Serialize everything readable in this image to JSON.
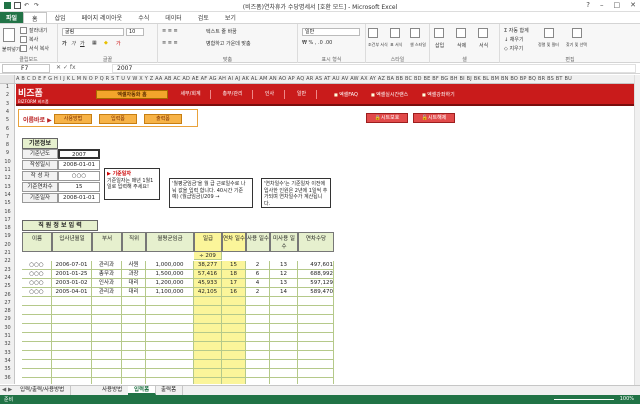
{
  "window": {
    "title": "(비즈폼)연차휴가 수당명세서 [호환 모드] - Microsoft Excel"
  },
  "tabs": [
    "파일",
    "홈",
    "삽입",
    "페이지 레이아웃",
    "수식",
    "데이터",
    "검토",
    "보기"
  ],
  "ribbon": {
    "paste": "붙여넣기",
    "cut": "잘라내기",
    "copy": "복사",
    "format_painter": "서식 복사",
    "clipboard": "클립보드",
    "font_name": "굴림",
    "font_size": "10",
    "font_group": "글꼴",
    "align_group": "맞춤",
    "wrap": "텍스트 줄 바꿈",
    "merge": "병합하고 가운데 맞춤",
    "number_format": "일반",
    "number_group": "표시 형식",
    "cond_fmt": "조건부 서식",
    "table_fmt": "표 서식",
    "cell_style": "셀 스타일",
    "style_group": "스타일",
    "insert": "삽입",
    "delete": "삭제",
    "format": "서식",
    "cells_group": "셀",
    "autosum": "자동 합계",
    "fill": "채우기",
    "clear": "지우기",
    "sort": "정렬 및 필터",
    "find": "찾기 및 선택",
    "edit_group": "편집"
  },
  "formula": {
    "name_box": "F7",
    "value": "2007"
  },
  "columns": "A B C D E F G H I J K L M N O P Q R S T U V W X Y Z AA AB AC AD AE AF AG AH AI AJ AK AL AM AN AO AP AQ AR AS AT AU AV AW AX AY AZ BA BB BC BD BE BF BG BH BI BJ BK BL BM BN BO BP BQ BR BS BT BU",
  "rows": [
    "1",
    "2",
    "3",
    "4",
    "5",
    "6",
    "7",
    "8",
    "9",
    "10",
    "11",
    "12",
    "13",
    "14",
    "15",
    "16",
    "17",
    "18",
    "19",
    "20",
    "21",
    "22",
    "23",
    "24",
    "25",
    "26",
    "27",
    "28",
    "29",
    "30",
    "31",
    "32",
    "33",
    "34",
    "35",
    "36"
  ],
  "banner": {
    "logo": "비즈폼",
    "logo_sub": "BIZFORM 비즈폼",
    "nav": [
      "엑셀자동화 홈",
      "세무/회계",
      "총무/관리",
      "인사",
      "일반"
    ],
    "links": [
      "엑셀FAQ",
      "엑셀실시간랜스",
      "엑셀강좌하기"
    ]
  },
  "sub": {
    "title": "이름바로 ▶",
    "buttons": [
      "사용방법",
      "입력폼",
      "출력폼"
    ],
    "protect": "시트보호",
    "unprotect": "시트해제"
  },
  "basic": {
    "title": "기본정보",
    "labels": [
      "기준년도",
      "작성일시",
      "작 성 자",
      "기준연차수",
      "기준일자"
    ],
    "values": [
      "2007",
      "2008-01-01",
      "○○○",
      "15",
      "2008-01-01"
    ]
  },
  "notes": {
    "n1_title": "▶ 기준일자",
    "n1_body": "기준일자는 매년 1월1일로 입력해 주세요!",
    "n2": "'월평균임금'을 월 급 근로일수로 나눠 값을 입력 합니다. 40시간 기준 예) (월급임금)/209 →",
    "n3": "'연차일수'는 기준일자 이전에 입사한 인원은 2년에 1일씩 추가되며 연차일수가 계산됩니다."
  },
  "table": {
    "title": "직 원 정 보 입 력",
    "headers": [
      "이름",
      "입사년월일",
      "부서",
      "직위",
      "월평균임금",
      "일급",
      "연차 일수",
      "사용 일수",
      "미사용 일수",
      "연차수당"
    ],
    "divisor_label": "÷",
    "divisor": "209",
    "rows": [
      [
        "○○○",
        "2006-07-01",
        "관리과",
        "사원",
        "1,000,000",
        "38,277",
        "15",
        "2",
        "13",
        "497,601"
      ],
      [
        "○○○",
        "2001-01-25",
        "총무과",
        "과장",
        "1,500,000",
        "57,416",
        "18",
        "6",
        "12",
        "688,992"
      ],
      [
        "○○○",
        "2003-01-02",
        "인사과",
        "대리",
        "1,200,000",
        "45,933",
        "17",
        "4",
        "13",
        "597,129"
      ],
      [
        "○○○",
        "2005-04-01",
        "관리과",
        "대리",
        "1,100,000",
        "42,105",
        "16",
        "2",
        "14",
        "589,470"
      ]
    ]
  },
  "sheet_tabs": [
    "입력/출력/사용방법",
    "사용방법",
    "입력폼",
    "출력폼"
  ],
  "status": {
    "ready": "준비",
    "zoom": "100%"
  }
}
